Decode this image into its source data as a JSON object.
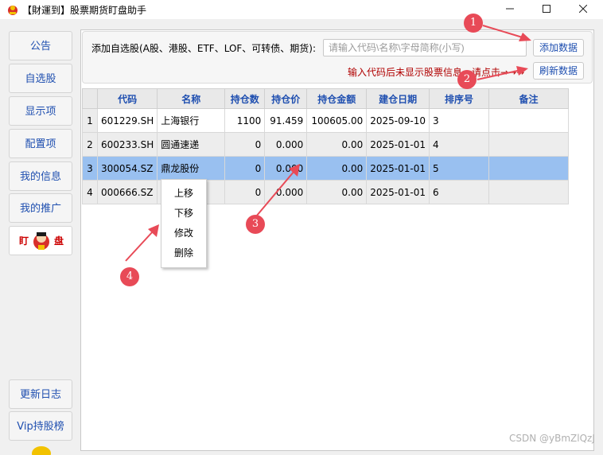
{
  "window": {
    "title": "【財運到】股票期货盯盘助手",
    "min_icon": "minimize-icon",
    "max_icon": "maximize-icon",
    "close_icon": "close-icon"
  },
  "sidebar": {
    "items": [
      {
        "label": "公告"
      },
      {
        "label": "自选股"
      },
      {
        "label": "显示项"
      },
      {
        "label": "配置项"
      },
      {
        "label": "我的信息"
      },
      {
        "label": "我的推广"
      }
    ],
    "ding_left": "盯",
    "ding_right": "盘",
    "bottom_items": [
      {
        "label": "更新日志"
      },
      {
        "label": "Vip持股榜"
      }
    ]
  },
  "toolbar": {
    "add_label": "添加自选股(A股、港股、ETF、LOF、可转债、期货):",
    "search_placeholder": "请输入代码\\名称\\字母简称(小写)",
    "add_button": "添加数据",
    "hint": "输入代码后未显示股票信息，请点击→→→",
    "refresh_button": "刷新数据"
  },
  "table": {
    "columns": [
      "代码",
      "名称",
      "持仓数",
      "持仓价",
      "持仓金额",
      "建仓日期",
      "排序号",
      "备注"
    ],
    "rows": [
      {
        "index": "1",
        "code": "601229.SH",
        "name": "上海银行",
        "qty": "1100",
        "price": "91.459",
        "amount": "100605.00",
        "date": "2025-09-10",
        "order": "3",
        "note": ""
      },
      {
        "index": "2",
        "code": "600233.SH",
        "name": "圆通速递",
        "qty": "0",
        "price": "0.000",
        "amount": "0.00",
        "date": "2025-01-01",
        "order": "4",
        "note": ""
      },
      {
        "index": "3",
        "code": "300054.SZ",
        "name": "鼎龙股份",
        "qty": "0",
        "price": "0.000",
        "amount": "0.00",
        "date": "2025-01-01",
        "order": "5",
        "note": ""
      },
      {
        "index": "4",
        "code": "000666.SZ",
        "name": "",
        "qty": "0",
        "price": "0.000",
        "amount": "0.00",
        "date": "2025-01-01",
        "order": "6",
        "note": ""
      }
    ]
  },
  "context_menu": {
    "items": [
      "上移",
      "下移",
      "修改",
      "删除"
    ]
  },
  "annotations": {
    "markers": [
      "1",
      "2",
      "3",
      "4"
    ],
    "color": "#e84a57"
  },
  "watermark": "CSDN @yBmZlQzJ"
}
